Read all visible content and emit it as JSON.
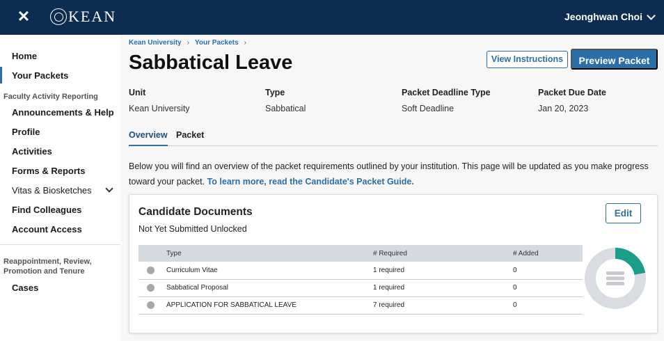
{
  "header": {
    "close_icon": "close-icon",
    "logo_text": "KEAN",
    "user_name": "Jeonghwan Choi"
  },
  "sidebar": {
    "items_top": [
      {
        "label": "Home"
      },
      {
        "label": "Your Packets",
        "active": true
      }
    ],
    "section_faculty": "Faculty Activity Reporting",
    "items_far": [
      {
        "label": "Announcements & Help"
      },
      {
        "label": "Profile"
      },
      {
        "label": "Activities"
      },
      {
        "label": "Forms & Reports"
      },
      {
        "label": "Vitas & Biosketches",
        "expandable": true
      },
      {
        "label": "Find Colleagues"
      },
      {
        "label": "Account Access"
      }
    ],
    "section_rpt_line1": "Reappointment, Review,",
    "section_rpt_line2": "Promotion and Tenure",
    "items_rpt": [
      {
        "label": "Cases"
      }
    ]
  },
  "breadcrumb": [
    "Kean University",
    "Your Packets"
  ],
  "page": {
    "title": "Sabbatical Leave",
    "view_instructions": "View Instructions",
    "preview_packet": "Preview Packet"
  },
  "meta": [
    {
      "label": "Unit",
      "value": "Kean University"
    },
    {
      "label": "Type",
      "value": "Sabbatical"
    },
    {
      "label": "Packet Deadline Type",
      "value": "Soft Deadline"
    },
    {
      "label": "Packet Due Date",
      "value": "Jan 20, 2023"
    }
  ],
  "tabs": [
    {
      "label": "Overview",
      "active": true
    },
    {
      "label": "Packet"
    }
  ],
  "intro": {
    "text": "Below you will find an overview of the packet requirements outlined by your institution. This page will be updated as you make progress toward your packet.",
    "link": "To learn more, read the Candidate's Packet Guide."
  },
  "card": {
    "title": "Candidate Documents",
    "status": "Not Yet Submitted Unlocked",
    "edit_label": "Edit",
    "columns": [
      "Type",
      "# Required",
      "# Added"
    ],
    "rows": [
      {
        "type": "Curriculum Vitae",
        "required": "1 required",
        "added": "0"
      },
      {
        "type": "Sabbatical Proposal",
        "required": "1 required",
        "added": "0"
      },
      {
        "type": "APPLICATION FOR SABBATICAL LEAVE",
        "required": "7 required",
        "added": "0"
      }
    ],
    "progress_fraction": 0.22,
    "colors": {
      "progress": "#1a9e8a",
      "track": "#d9dce0",
      "icon": "#c6c9cd"
    }
  }
}
